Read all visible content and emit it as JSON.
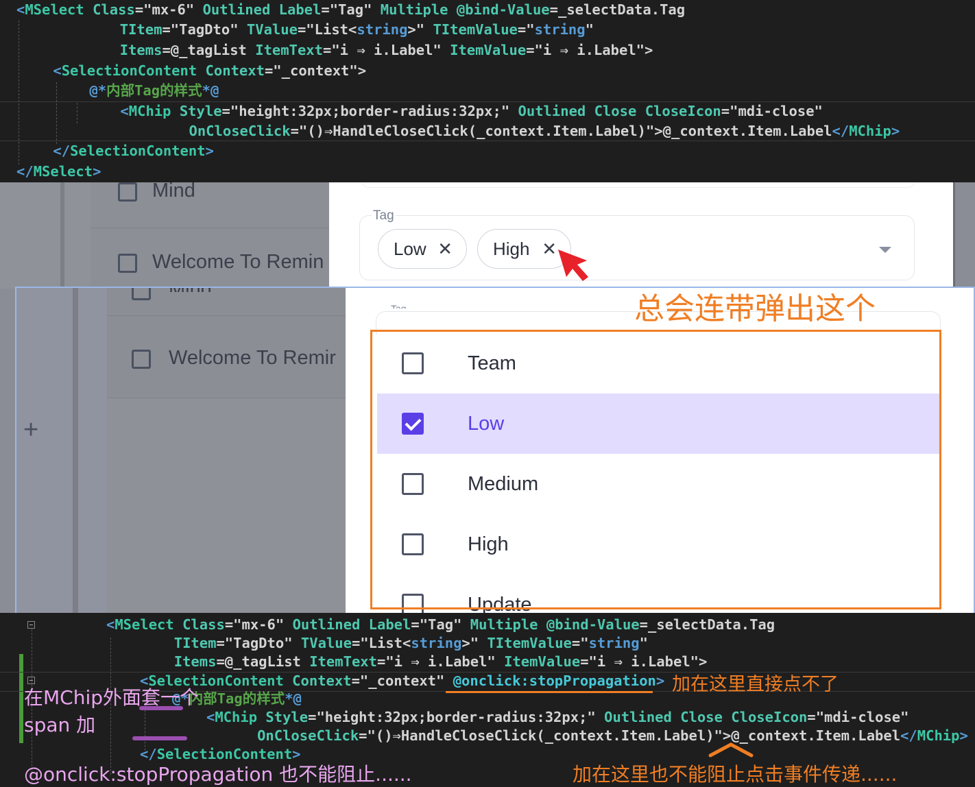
{
  "code_top": {
    "lines": [
      [
        {
          "t": "<",
          "c": "tag"
        },
        {
          "t": "MSelect",
          "c": "tagname"
        },
        {
          "t": " Class",
          "c": "attr"
        },
        {
          "t": "=\"mx-6\" ",
          "c": "str"
        },
        {
          "t": "Outlined",
          "c": "attr"
        },
        {
          "t": " ",
          "c": "str"
        },
        {
          "t": "Label",
          "c": "attr"
        },
        {
          "t": "=\"Tag\" ",
          "c": "str"
        },
        {
          "t": "Multiple",
          "c": "attr"
        },
        {
          "t": " ",
          "c": "str"
        },
        {
          "t": "@bind-Value",
          "c": "attr"
        },
        {
          "t": "=_selectData.Tag",
          "c": "str"
        }
      ],
      [
        {
          "t": "        ",
          "c": "str"
        },
        {
          "t": "TItem",
          "c": "attr"
        },
        {
          "t": "=\"TagDto\" ",
          "c": "str"
        },
        {
          "t": "TValue",
          "c": "attr"
        },
        {
          "t": "=\"List<",
          "c": "str"
        },
        {
          "t": "string",
          "c": "tag"
        },
        {
          "t": ">\" ",
          "c": "str"
        },
        {
          "t": "TItemValue",
          "c": "attr"
        },
        {
          "t": "=\"",
          "c": "str"
        },
        {
          "t": "string",
          "c": "tag"
        },
        {
          "t": "\"",
          "c": "str"
        }
      ],
      [
        {
          "t": "        ",
          "c": "str"
        },
        {
          "t": "Items",
          "c": "attr"
        },
        {
          "t": "=@_tagList ",
          "c": "str"
        },
        {
          "t": "ItemText",
          "c": "attr"
        },
        {
          "t": "=\"i ⇒ i.Label\" ",
          "c": "str"
        },
        {
          "t": "ItemValue",
          "c": "attr"
        },
        {
          "t": "=\"i ⇒ i.Label\">",
          "c": "str"
        }
      ],
      [
        {
          "t": "    <",
          "c": "tag"
        },
        {
          "t": "SelectionContent",
          "c": "tagname"
        },
        {
          "t": " Context",
          "c": "attr"
        },
        {
          "t": "=\"_context\">",
          "c": "str"
        }
      ],
      [
        {
          "t": "       @*",
          "c": "tag"
        },
        {
          "t": "内部Tag的样式",
          "c": "cmt"
        },
        {
          "t": "*@",
          "c": "tag"
        }
      ],
      [
        {
          "t": "          <",
          "c": "tag"
        },
        {
          "t": "MChip",
          "c": "tagname"
        },
        {
          "t": " Style",
          "c": "attr"
        },
        {
          "t": "=\"height:32px;border-radius:32px;\" ",
          "c": "str"
        },
        {
          "t": "Outlined",
          "c": "attr"
        },
        {
          "t": " ",
          "c": "str"
        },
        {
          "t": "Close",
          "c": "attr"
        },
        {
          "t": " ",
          "c": "str"
        },
        {
          "t": "CloseIcon",
          "c": "attr"
        },
        {
          "t": "=\"mdi-close\"",
          "c": "str"
        }
      ],
      [
        {
          "t": "                ",
          "c": "str"
        },
        {
          "t": "OnCloseClick",
          "c": "attr"
        },
        {
          "t": "=\"()⇒HandleCloseClick(_context.Item.Label)\">",
          "c": "str"
        },
        {
          "t": "@_context.Item.Label",
          "c": "str"
        },
        {
          "t": "</",
          "c": "tag"
        },
        {
          "t": "MChip",
          "c": "tagname"
        },
        {
          "t": ">",
          "c": "tag"
        }
      ],
      [
        {
          "t": "    </",
          "c": "tag"
        },
        {
          "t": "SelectionContent",
          "c": "tagname"
        },
        {
          "t": ">",
          "c": "tag"
        }
      ],
      [
        {
          "t": "</",
          "c": "tag"
        },
        {
          "t": "MSelect",
          "c": "tagname"
        },
        {
          "t": ">",
          "c": "tag"
        }
      ]
    ]
  },
  "background_list": {
    "item1": "Mind",
    "item2": "Welcome To Remin"
  },
  "select": {
    "label": "Tag",
    "chips": [
      {
        "label": "Low",
        "close": "✕"
      },
      {
        "label": "High",
        "close": "✕"
      }
    ]
  },
  "lower_background": {
    "item1": "Mind",
    "item2": "Welcome To Remir",
    "add": "+",
    "ghost_label": "Tag"
  },
  "menu": {
    "items": [
      {
        "label": "Team",
        "checked": false
      },
      {
        "label": "Low",
        "checked": true
      },
      {
        "label": "Medium",
        "checked": false
      },
      {
        "label": "High",
        "checked": false
      },
      {
        "label": "Update",
        "checked": false
      }
    ]
  },
  "annotations": {
    "popup_note": "总会连带弹出这个",
    "onclick_note": "加在这里直接点不了",
    "span_note_1": "在MChip外面套一个",
    "span_note_2": "span 加",
    "stop_note": "@onclick:stopPropagation 也不能阻止......",
    "close_note": "加在这里也不能阻止点击事件传递......"
  },
  "code_bottom": {
    "lines": [
      [
        {
          "t": "<",
          "c": "tag"
        },
        {
          "t": "MSelect",
          "c": "tagname"
        },
        {
          "t": " Class",
          "c": "attr"
        },
        {
          "t": "=\"mx-6\" ",
          "c": "str"
        },
        {
          "t": "Outlined",
          "c": "attr"
        },
        {
          "t": " ",
          "c": "str"
        },
        {
          "t": "Label",
          "c": "attr"
        },
        {
          "t": "=\"Tag\" ",
          "c": "str"
        },
        {
          "t": "Multiple",
          "c": "attr"
        },
        {
          "t": " ",
          "c": "str"
        },
        {
          "t": "@bind-Value",
          "c": "attr"
        },
        {
          "t": "=_selectData.Tag",
          "c": "str"
        }
      ],
      [
        {
          "t": "        ",
          "c": "str"
        },
        {
          "t": "TItem",
          "c": "attr"
        },
        {
          "t": "=\"TagDto\" ",
          "c": "str"
        },
        {
          "t": "TValue",
          "c": "attr"
        },
        {
          "t": "=\"List<",
          "c": "str"
        },
        {
          "t": "string",
          "c": "tag"
        },
        {
          "t": ">\" ",
          "c": "str"
        },
        {
          "t": "TItemValue",
          "c": "attr"
        },
        {
          "t": "=\"",
          "c": "str"
        },
        {
          "t": "string",
          "c": "tag"
        },
        {
          "t": "\"",
          "c": "str"
        }
      ],
      [
        {
          "t": "        ",
          "c": "str"
        },
        {
          "t": "Items",
          "c": "attr"
        },
        {
          "t": "=@_tagList ",
          "c": "str"
        },
        {
          "t": "ItemText",
          "c": "attr"
        },
        {
          "t": "=\"i ⇒ i.Label\" ",
          "c": "str"
        },
        {
          "t": "ItemValue",
          "c": "attr"
        },
        {
          "t": "=\"i ⇒ i.Label\">",
          "c": "str"
        }
      ],
      [
        {
          "t": "<",
          "c": "tag"
        },
        {
          "t": "SelectionContent",
          "c": "tagname"
        },
        {
          "t": " Context",
          "c": "attr"
        },
        {
          "t": "=\"_context\" ",
          "c": "str"
        },
        {
          "t": "@onclick:stopPropagation",
          "c": "attr2"
        },
        {
          "t": ">",
          "c": "tag"
        }
      ],
      [
        {
          "t": "@*",
          "c": "tag"
        },
        {
          "t": "内部Tag的样式",
          "c": "cmt"
        },
        {
          "t": "*@",
          "c": "tag"
        }
      ],
      [
        {
          "t": "<",
          "c": "tag"
        },
        {
          "t": "MChip",
          "c": "tagname"
        },
        {
          "t": " Style",
          "c": "attr"
        },
        {
          "t": "=\"height:32px;border-radius:32px;\" ",
          "c": "str"
        },
        {
          "t": "Outlined",
          "c": "attr"
        },
        {
          "t": " ",
          "c": "str"
        },
        {
          "t": "Close",
          "c": "attr"
        },
        {
          "t": " ",
          "c": "str"
        },
        {
          "t": "CloseIcon",
          "c": "attr"
        },
        {
          "t": "=\"mdi-close\"",
          "c": "str"
        }
      ],
      [
        {
          "t": "      ",
          "c": "str"
        },
        {
          "t": "OnCloseClick",
          "c": "attr"
        },
        {
          "t": "=\"()⇒HandleCloseClick(_context.Item.Label)\">",
          "c": "str"
        },
        {
          "t": "@_context.Item.Label",
          "c": "str"
        },
        {
          "t": "</",
          "c": "tag"
        },
        {
          "t": "MChip",
          "c": "tagname"
        },
        {
          "t": ">",
          "c": "tag"
        }
      ],
      [
        {
          "t": "</",
          "c": "tag"
        },
        {
          "t": "SelectionContent",
          "c": "tagname"
        },
        {
          "t": ">",
          "c": "tag"
        }
      ]
    ]
  },
  "colors": {
    "accent": "#5b3fe6",
    "annotation": "#f07e24",
    "selected_bg": "#e2dcff"
  }
}
